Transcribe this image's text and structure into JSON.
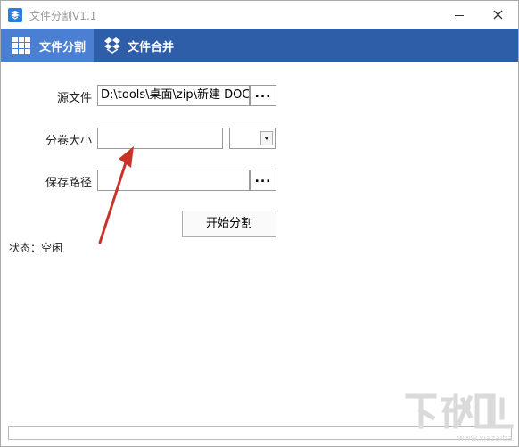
{
  "window": {
    "title": "文件分割V1.1",
    "icons": {
      "app": "dropbox-box-icon",
      "minimize": "minimize-icon",
      "close": "close-icon"
    }
  },
  "tabs": [
    {
      "label": "文件分割",
      "icon": "grid-icon",
      "active": true
    },
    {
      "label": "文件合并",
      "icon": "box-icon",
      "active": false
    }
  ],
  "form": {
    "source_label": "源文件",
    "source_value": "D:\\tools\\桌面\\zip\\新建 DOCX 文档.docx",
    "browse_label": "...",
    "split_size_label": "分卷大小",
    "split_size_value": "",
    "unit_value": "",
    "save_path_label": "保存路径",
    "save_path_value": "",
    "start_button": "开始分割"
  },
  "status": {
    "text": "状态：空闲"
  },
  "progress": {
    "value": 0
  },
  "colors": {
    "tab_bar": "#2f5ea8",
    "tab_active": "#4a7fd3",
    "arrow": "#c8342a"
  }
}
